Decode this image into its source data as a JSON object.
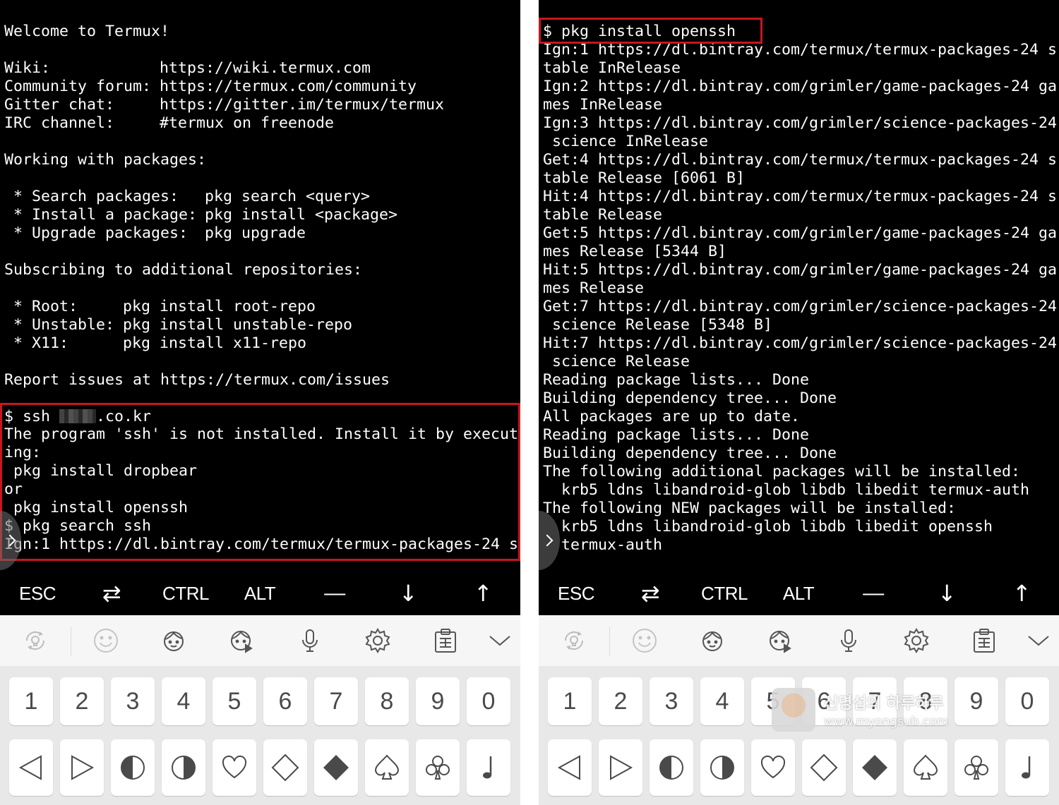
{
  "left": {
    "welcome": "Welcome to Termux!",
    "wiki_label": "Wiki:",
    "wiki_url": "https://wiki.termux.com",
    "forum_label": "Community forum:",
    "forum_url": "https://termux.com/community",
    "gitter_label": "Gitter chat:",
    "gitter_url": "https://gitter.im/termux/termux",
    "irc_label": "IRC channel:",
    "irc_value": "#termux on freenode",
    "working_header": "Working with packages:",
    "pkg_search_label": " * Search packages:",
    "pkg_search_cmd": "pkg search <query>",
    "pkg_install_label": " * Install a package:",
    "pkg_install_cmd": "pkg install <package>",
    "pkg_upgrade_label": " * Upgrade packages:",
    "pkg_upgrade_cmd": "pkg upgrade",
    "repos_header": "Subscribing to additional repositories:",
    "root_label": " * Root:",
    "root_cmd": "pkg install root-repo",
    "unstable_label": " * Unstable:",
    "unstable_cmd": "pkg install unstable-repo",
    "x11_label": " * X11:",
    "x11_cmd": "pkg install x11-repo",
    "report": "Report issues at https://termux.com/issues",
    "ssh_cmd_prefix": "$ ssh ",
    "ssh_cmd_suffix": ".co.kr",
    "not_installed_1": "The program 'ssh' is not installed. Install it by execut",
    "not_installed_2": "ing:",
    "opt_dropbear": " pkg install dropbear",
    "or": "or",
    "opt_openssh": " pkg install openssh",
    "search_cmd": "$ pkg search ssh",
    "ign_line": "Ign:1 https://dl.bintray.com/termux/termux-packages-24 s"
  },
  "right": {
    "lines": [
      "$ pkg install openssh",
      "Ign:1 https://dl.bintray.com/termux/termux-packages-24 s",
      "table InRelease",
      "Ign:2 https://dl.bintray.com/grimler/game-packages-24 ga",
      "mes InRelease",
      "Ign:3 https://dl.bintray.com/grimler/science-packages-24",
      " science InRelease",
      "Get:4 https://dl.bintray.com/termux/termux-packages-24 s",
      "table Release [6061 B]",
      "Hit:4 https://dl.bintray.com/termux/termux-packages-24 s",
      "table Release",
      "Get:5 https://dl.bintray.com/grimler/game-packages-24 ga",
      "mes Release [5344 B]",
      "Hit:5 https://dl.bintray.com/grimler/game-packages-24 ga",
      "mes Release",
      "Get:7 https://dl.bintray.com/grimler/science-packages-24",
      " science Release [5348 B]",
      "Hit:7 https://dl.bintray.com/grimler/science-packages-24",
      " science Release",
      "Reading package lists... Done",
      "Building dependency tree... Done",
      "All packages are up to date.",
      "Reading package lists... Done",
      "Building dependency tree... Done",
      "The following additional packages will be installed:",
      "  krb5 ldns libandroid-glob libdb libedit termux-auth",
      "The following NEW packages will be installed:",
      "  krb5 ldns libandroid-glob libdb libedit openssh",
      "  termux-auth"
    ]
  },
  "extra_keys": {
    "esc": "ESC",
    "tab": "⇄",
    "ctrl": "CTRL",
    "alt": "ALT",
    "dash": "—",
    "down": "↓",
    "up": "↑"
  },
  "keyboard": {
    "numbers": [
      "1",
      "2",
      "3",
      "4",
      "5",
      "6",
      "7",
      "8",
      "9",
      "0"
    ],
    "symbol_keys": [
      "left-triangle-icon",
      "right-triangle-icon",
      "half-circle-left-icon",
      "half-circle-right-icon",
      "heart-icon",
      "diamond-outline-icon",
      "diamond-filled-icon",
      "spade-icon",
      "club-icon",
      "music-note-icon"
    ],
    "toolbar_icons": [
      "bixby-vision-icon",
      "emoji-icon",
      "ar-emoji-icon",
      "animated-emoji-icon",
      "microphone-icon",
      "settings-gear-icon",
      "clipboard-icon",
      "collapse-chevron-icon"
    ]
  },
  "watermark": {
    "title": "신명섭의 하루하루",
    "url": "www.myongsub.com"
  },
  "colors": {
    "terminal_bg": "#000000",
    "terminal_text": "#ffffff",
    "highlight_box": "#c8161d",
    "keyboard_bg": "#e8e8e8",
    "toolbar_bg": "#f6f6f6",
    "key_bg": "#ffffff",
    "key_text": "#4a4a4a"
  }
}
